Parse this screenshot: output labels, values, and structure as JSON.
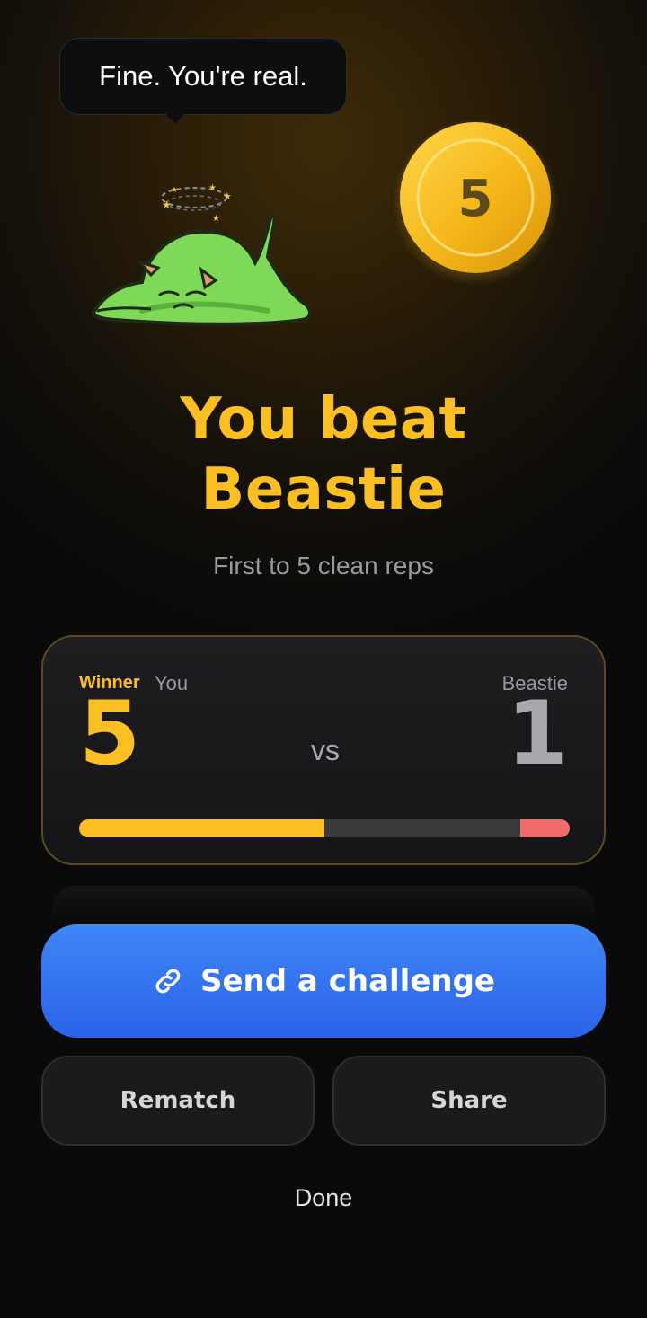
{
  "speech_bubble": {
    "text": "Fine. You're real."
  },
  "coin": {
    "value": "5",
    "icon": "coin-icon"
  },
  "mascot": {
    "icon": "dizzy-monster-icon"
  },
  "result": {
    "headline_line1": "You beat",
    "headline_line2": "Beastie",
    "subtitle": "First to 5 clean reps"
  },
  "scoreboard": {
    "winner_label": "Winner",
    "player_label": "You",
    "opponent_label": "Beastie",
    "player_score": "5",
    "opponent_score": "1",
    "vs_label": "vs",
    "player_progress_fraction": 0.5,
    "opponent_progress_fraction": 0.1
  },
  "actions": {
    "primary_label": "Send a challenge",
    "primary_icon": "link-icon",
    "rematch_label": "Rematch",
    "share_label": "Share",
    "done_label": "Done"
  },
  "colors": {
    "accent": "#fbbf24",
    "primary_button": "#3478f6",
    "opponent_bar": "#f26b6b",
    "background": "#0a0a0b"
  }
}
